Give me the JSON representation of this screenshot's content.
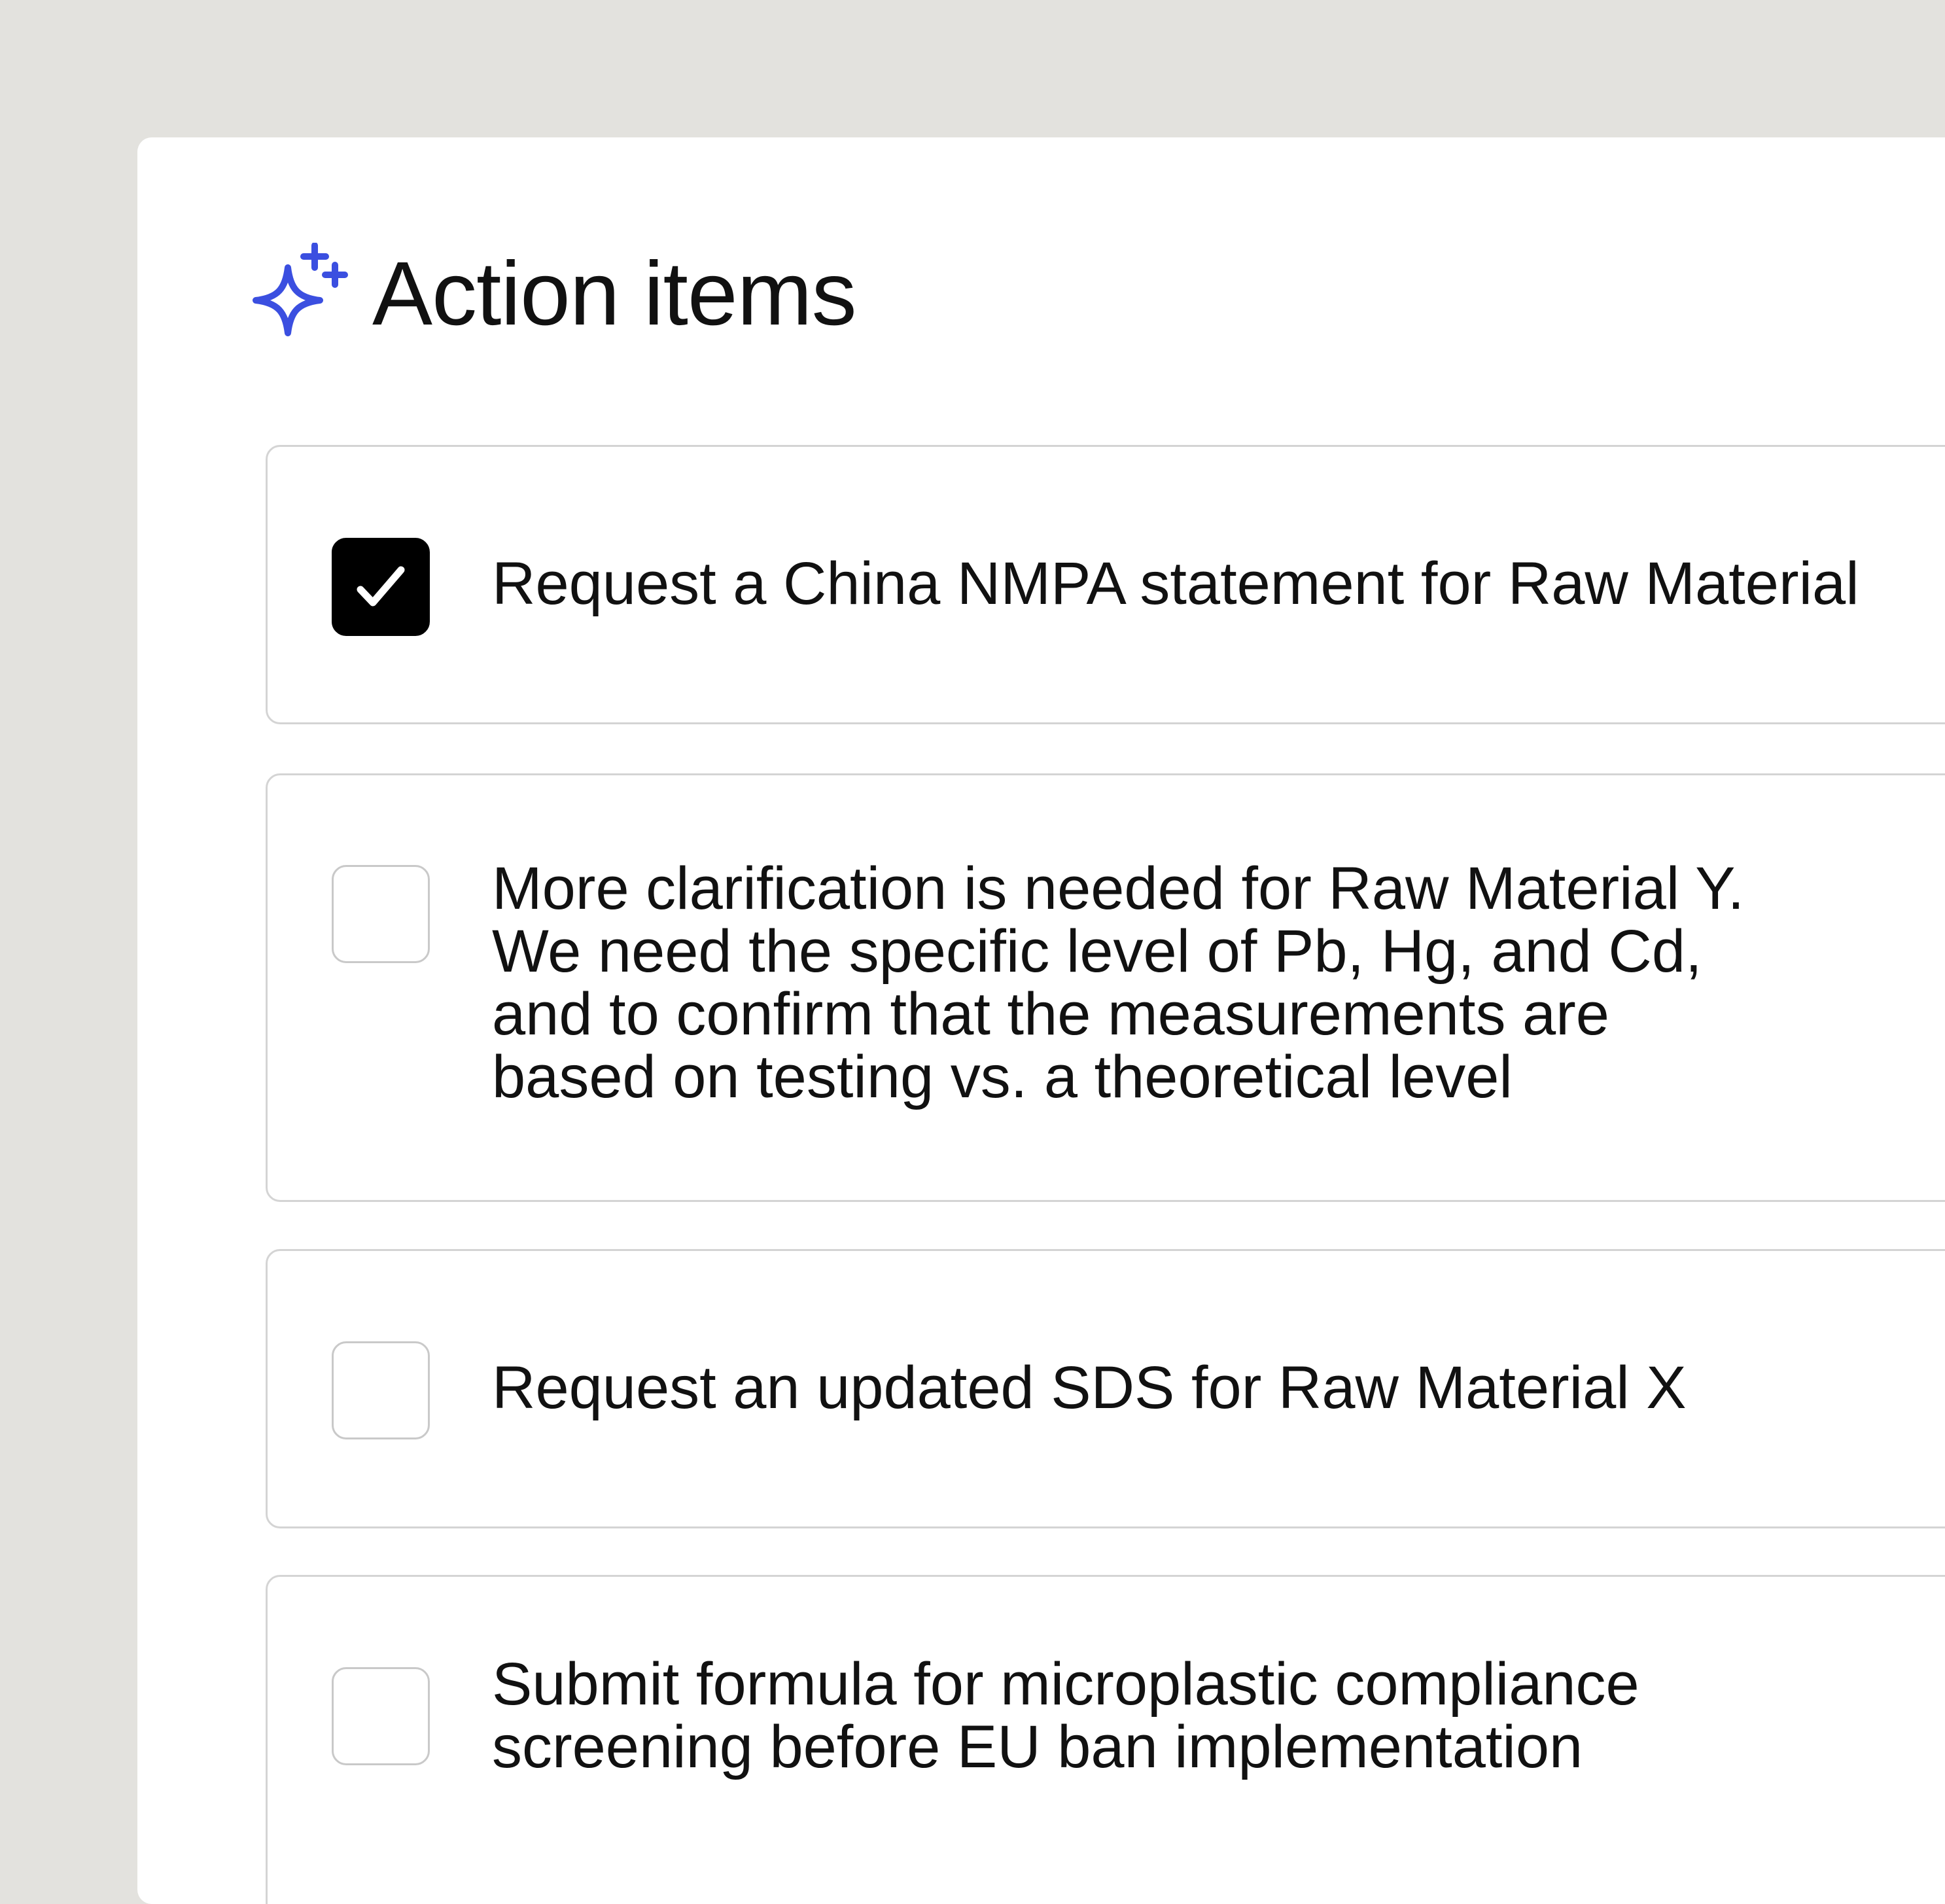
{
  "app": {
    "accent_color": "#3b4fe0"
  },
  "header": {
    "icon": "sparkle-icon",
    "title": "Action items"
  },
  "items": [
    {
      "checked": true,
      "text": "Request a China NMPA statement for Raw Material"
    },
    {
      "checked": false,
      "text": "More clarification is needed for Raw Material Y.\nWe need the specific level of Pb, Hg, and Cd,\nand to confirm that the measurements are\nbased on testing vs. a theoretical level"
    },
    {
      "checked": false,
      "text": "Request an updated SDS for Raw Material X"
    },
    {
      "checked": false,
      "text": "Submit formula for microplastic compliance\nscreening before EU ban implementation"
    }
  ]
}
